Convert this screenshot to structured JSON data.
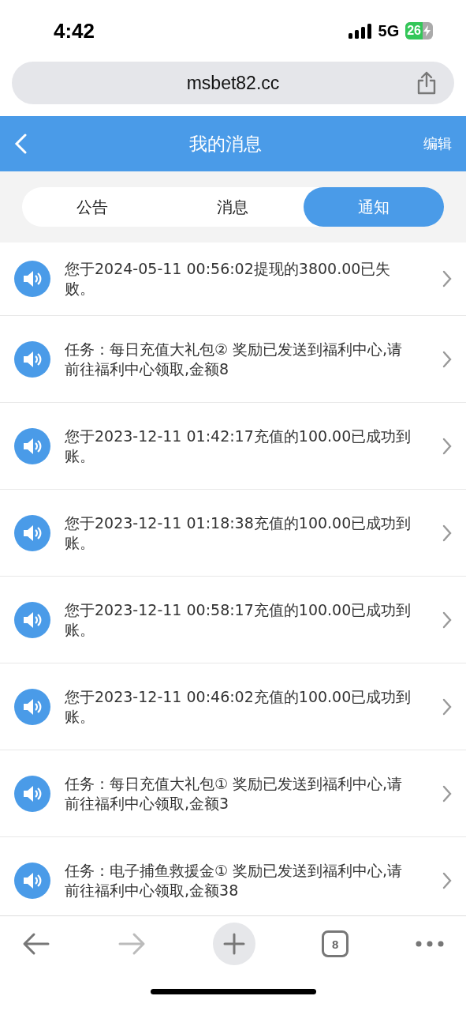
{
  "status_bar": {
    "time": "4:42",
    "network": "5G",
    "battery": "26"
  },
  "address_bar": {
    "url": "msbet82.cc"
  },
  "header": {
    "title": "我的消息",
    "action": "编辑"
  },
  "tabs": [
    {
      "label": "公告",
      "selected": false
    },
    {
      "label": "消息",
      "selected": false
    },
    {
      "label": "通知",
      "selected": true
    }
  ],
  "notifications": [
    {
      "text": "您于2024-05-11 00:56:02提现的3800.00已失败。"
    },
    {
      "text": "任务：每日充值大礼包② 奖励已发送到福利中心,请前往福利中心领取,金额8"
    },
    {
      "text": "您于2023-12-11 01:42:17充值的100.00已成功到账。"
    },
    {
      "text": "您于2023-12-11 01:18:38充值的100.00已成功到账。"
    },
    {
      "text": "您于2023-12-11 00:58:17充值的100.00已成功到账。"
    },
    {
      "text": "您于2023-12-11 00:46:02充值的100.00已成功到账。"
    },
    {
      "text": "任务：每日充值大礼包① 奖励已发送到福利中心,请前往福利中心领取,金额3"
    },
    {
      "text": "任务：电子捕鱼救援金① 奖励已发送到福利中心,请前往福利中心领取,金额38"
    }
  ],
  "browser_toolbar": {
    "tab_count": "8"
  }
}
